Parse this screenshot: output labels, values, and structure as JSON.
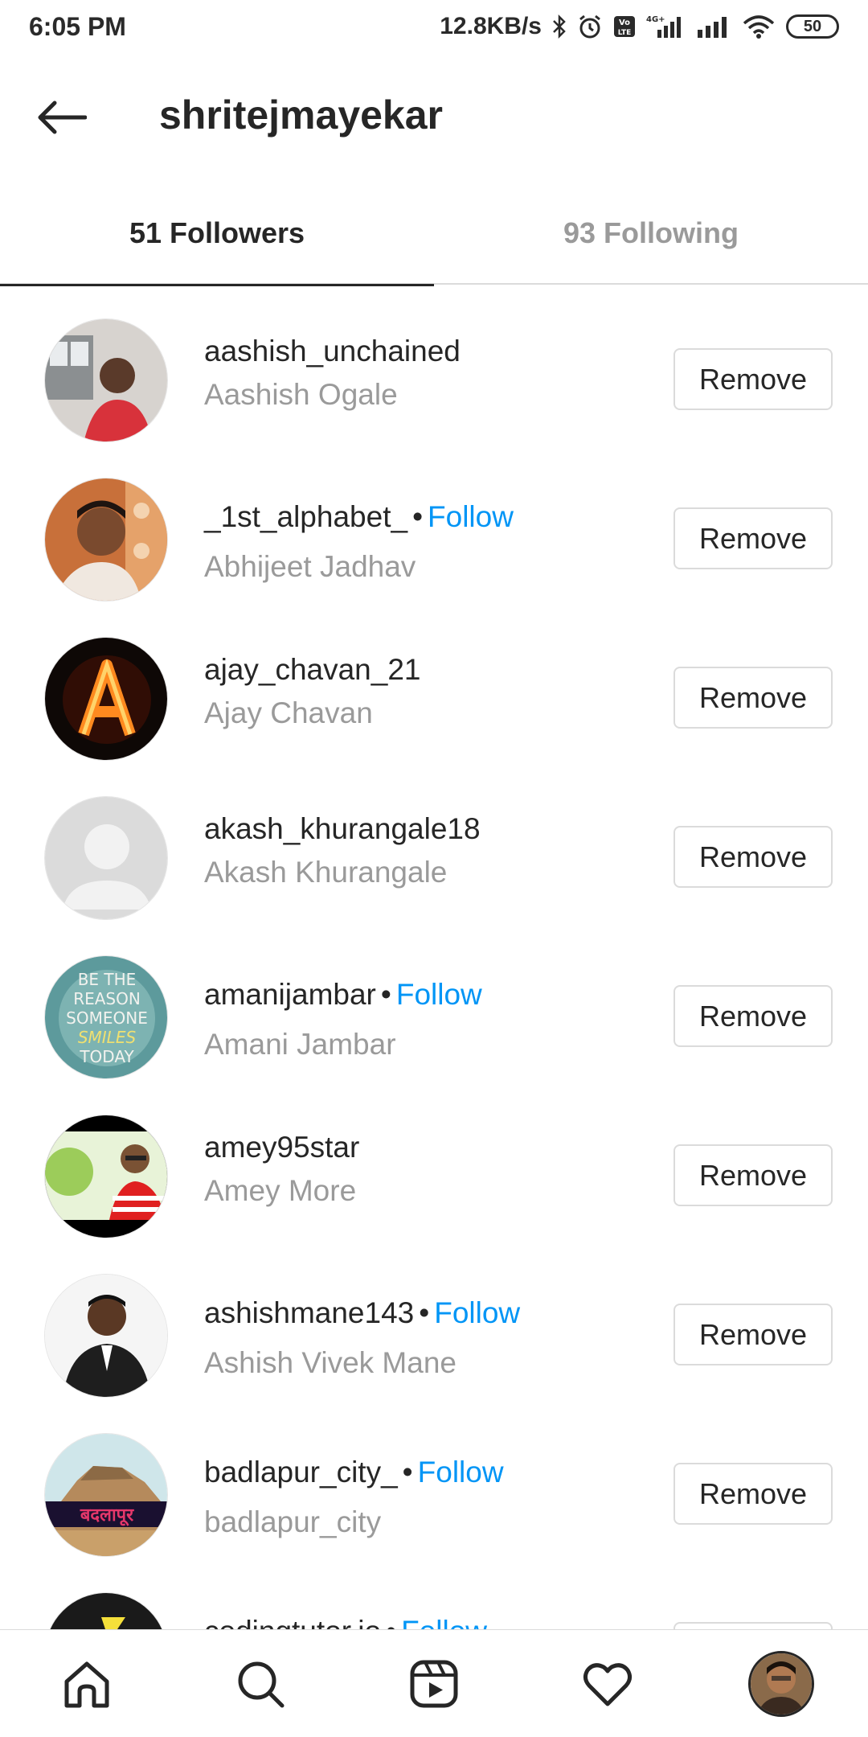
{
  "status_bar": {
    "time": "6:05 PM",
    "net_speed": "12.8KB/s",
    "battery": "50"
  },
  "header": {
    "title": "shritejmayekar"
  },
  "tabs": {
    "followers": "51 Followers",
    "following": "93 Following"
  },
  "remove_label": "Remove",
  "follow_label": "Follow",
  "followers": [
    {
      "username": "aashish_unchained",
      "fullname": "Aashish Ogale",
      "show_follow": false,
      "avatar_icon": "photo-man-red-shirt"
    },
    {
      "username": "_1st_alphabet_",
      "fullname": "Abhijeet Jadhav",
      "show_follow": true,
      "avatar_icon": "photo-man-profile"
    },
    {
      "username": "ajay_chavan_21",
      "fullname": "Ajay Chavan",
      "show_follow": false,
      "avatar_icon": "fire-letter-a"
    },
    {
      "username": "akash_khurangale18",
      "fullname": "Akash Khurangale",
      "show_follow": false,
      "avatar_icon": "default-avatar"
    },
    {
      "username": "amanijambar",
      "fullname": "Amani Jambar",
      "show_follow": true,
      "avatar_icon": "quote-image"
    },
    {
      "username": "amey95star",
      "fullname": "Amey More",
      "show_follow": false,
      "avatar_icon": "photo-man-outdoors"
    },
    {
      "username": "ashishmane143",
      "fullname": "Ashish Vivek Mane",
      "show_follow": true,
      "avatar_icon": "photo-man-suit"
    },
    {
      "username": "badlapur_city_",
      "fullname": "badlapur_city",
      "show_follow": true,
      "avatar_icon": "city-logo"
    },
    {
      "username": "codingtutor.io",
      "fullname": "",
      "show_follow": true,
      "avatar_icon": "logo-dark"
    }
  ],
  "bottom_nav": [
    "home-icon",
    "search-icon",
    "reels-icon",
    "heart-icon",
    "profile-avatar"
  ],
  "colors": {
    "follow_blue": "#0095f6",
    "text": "#262626",
    "secondary": "#9a9a9a",
    "border": "#dbdbdb"
  }
}
